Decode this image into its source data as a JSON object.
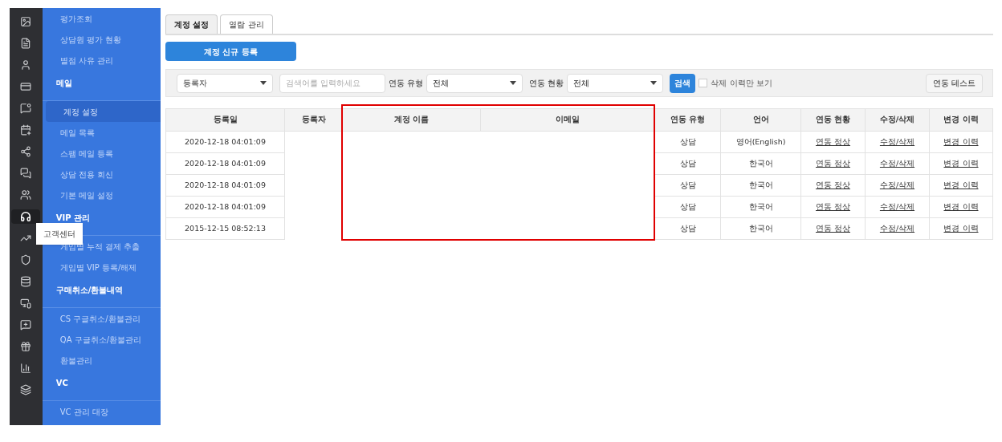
{
  "icon_rail": {
    "items": [
      {
        "selected": false
      },
      {
        "selected": false
      },
      {
        "selected": false
      },
      {
        "selected": false
      },
      {
        "selected": false
      },
      {
        "selected": false
      },
      {
        "selected": false
      },
      {
        "selected": false
      },
      {
        "selected": false
      },
      {
        "selected": true
      },
      {
        "selected": false
      },
      {
        "selected": false
      },
      {
        "selected": false
      },
      {
        "selected": false
      },
      {
        "selected": false
      },
      {
        "selected": false
      },
      {
        "selected": false
      },
      {
        "selected": false
      }
    ],
    "tooltip": "고객센터"
  },
  "menu": [
    {
      "kind": "item",
      "label": "평가조회",
      "selected": false
    },
    {
      "kind": "item",
      "label": "상담원 평가 현황",
      "selected": false
    },
    {
      "kind": "item",
      "label": "별점 사유 관리",
      "selected": false
    },
    {
      "kind": "header",
      "label": "메일"
    },
    {
      "kind": "item",
      "label": "계정 설정",
      "selected": true
    },
    {
      "kind": "item",
      "label": "메일 목록",
      "selected": false
    },
    {
      "kind": "item",
      "label": "스팸 메일 등록",
      "selected": false
    },
    {
      "kind": "item",
      "label": "상담 전용 회신",
      "selected": false
    },
    {
      "kind": "item",
      "label": "기본 메일 설정",
      "selected": false
    },
    {
      "kind": "header",
      "label": "VIP 관리"
    },
    {
      "kind": "item",
      "label": "게임별 누적 결제 추출",
      "selected": false
    },
    {
      "kind": "item",
      "label": "게임별 VIP 등록/해제",
      "selected": false
    },
    {
      "kind": "header",
      "label": "구매취소/환불내역"
    },
    {
      "kind": "item",
      "label": "CS 구글취소/환불관리",
      "selected": false
    },
    {
      "kind": "item",
      "label": "QA 구글취소/환불관리",
      "selected": false
    },
    {
      "kind": "item",
      "label": "환불관리",
      "selected": false
    },
    {
      "kind": "header",
      "label": "VC"
    },
    {
      "kind": "item",
      "label": "VC 관리 대장",
      "selected": false
    }
  ],
  "tabs": [
    {
      "label": "계정 설정",
      "selected": true
    },
    {
      "label": "열람 관리",
      "selected": false
    }
  ],
  "new_button": "계정 신규 등록",
  "filters": {
    "registrant_select": "등록자",
    "search": {
      "placeholder": "검색어를 입력하세요"
    },
    "type_label": "연동 유형",
    "type_select": "전체",
    "status_label": "연동 현황",
    "status_select": "전체",
    "search_button": "검색",
    "deleted_only": {
      "label": "삭제 이력만 보기",
      "checked": false
    },
    "test_button": "연동 테스트"
  },
  "table": {
    "columns": [
      "등록일",
      "등록자",
      "계정 이름",
      "이메일",
      "연동 유형",
      "언어",
      "연동 현황",
      "수정/삭제",
      "변경 이력"
    ],
    "rows": [
      {
        "date": "2020-12-18 04:01:09",
        "type": "상담",
        "language": "영어(English)",
        "status": "연동 정상",
        "edit": "수정/삭제",
        "history": "변경 이력"
      },
      {
        "date": "2020-12-18 04:01:09",
        "type": "상담",
        "language": "한국어",
        "status": "연동 정상",
        "edit": "수정/삭제",
        "history": "변경 이력"
      },
      {
        "date": "2020-12-18 04:01:09",
        "type": "상담",
        "language": "한국어",
        "status": "연동 정상",
        "edit": "수정/삭제",
        "history": "변경 이력"
      },
      {
        "date": "2020-12-18 04:01:09",
        "type": "상담",
        "language": "한국어",
        "status": "연동 정상",
        "edit": "수정/삭제",
        "history": "변경 이력"
      },
      {
        "date": "2015-12-15 08:52:13",
        "type": "상담",
        "language": "한국어",
        "status": "연동 정상",
        "edit": "수정/삭제",
        "history": "변경 이력"
      }
    ]
  }
}
